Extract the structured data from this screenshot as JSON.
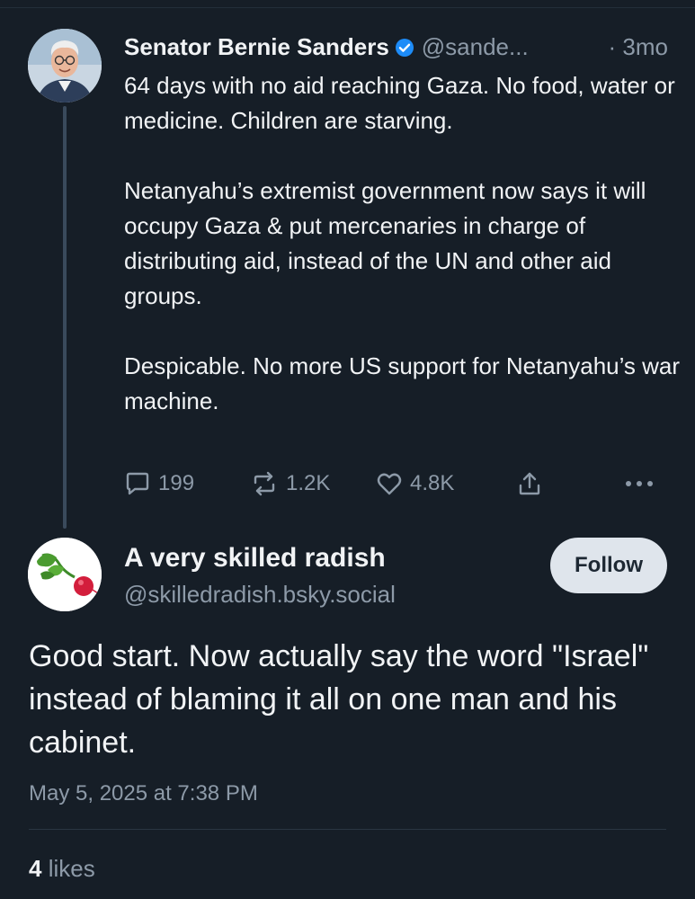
{
  "parent_post": {
    "author_name": "Senator Bernie Sanders",
    "verified_icon": "verified-check-icon",
    "handle": "@sande...",
    "time": "· 3mo",
    "paragraphs": [
      "64 days with no aid reaching Gaza. No food, water or medicine. Children are starving.",
      "Netanyahu’s extremist government now says it will occupy Gaza & put mercenaries in charge of distributing aid, instead of the UN and other aid groups.",
      "Despicable. No more US support for Netanyahu’s war machine."
    ],
    "actions": {
      "replies": "199",
      "reposts": "1.2K",
      "likes": "4.8K"
    }
  },
  "reply_post": {
    "author_name": "A very skilled radish",
    "handle": "@skilledradish.bsky.social",
    "follow_label": "Follow",
    "text": "Good start. Now actually say the word \"Israel\" instead of blaming it all on one man and his cabinet.",
    "timestamp": "May 5, 2025 at 7:38 PM",
    "likes_count": "4",
    "likes_label": "likes"
  },
  "colors": {
    "background": "#161e27",
    "muted_text": "#8d9aa8",
    "verified_blue": "#1d8cf8"
  }
}
